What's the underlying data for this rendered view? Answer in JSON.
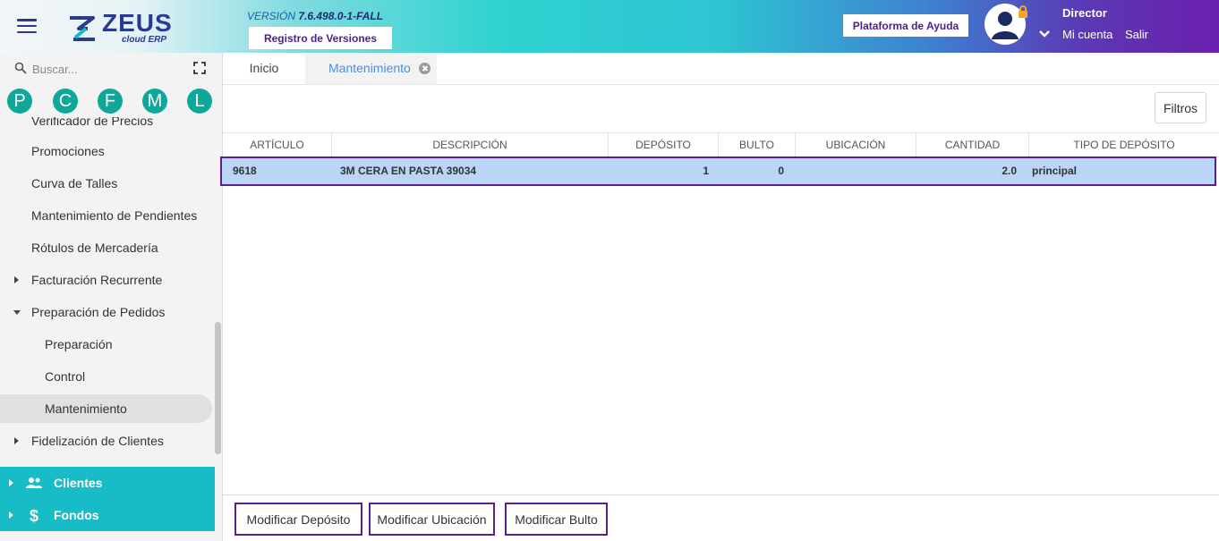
{
  "header": {
    "logo_text": "ZEUS",
    "logo_sub": "cloud ERP",
    "version_label": "VERSIÓN",
    "version_value": "7.6.498.0-1-FALL",
    "registro_label": "Registro de Versiones",
    "ayuda_label": "Plataforma de Ayuda",
    "user_role": "Director",
    "mi_cuenta": "Mi cuenta",
    "salir": "Salir"
  },
  "sidebar": {
    "search_placeholder": "Buscar...",
    "letters": [
      "P",
      "C",
      "F",
      "M",
      "L"
    ],
    "items": [
      {
        "label": "Verificador de Precios"
      },
      {
        "label": "Promociones"
      },
      {
        "label": "Curva de Talles"
      },
      {
        "label": "Mantenimiento de Pendientes"
      },
      {
        "label": "Rótulos de Mercadería"
      },
      {
        "label": "Facturación Recurrente"
      },
      {
        "label": "Preparación de Pedidos"
      },
      {
        "label": "Preparación"
      },
      {
        "label": "Control"
      },
      {
        "label": "Mantenimiento"
      },
      {
        "label": "Fidelización de Clientes"
      }
    ],
    "sections": [
      {
        "label": "Clientes",
        "icon": "people-icon"
      },
      {
        "label": "Fondos",
        "icon": "dollar-icon"
      }
    ]
  },
  "tabs": [
    {
      "label": "Inicio"
    },
    {
      "label": "Mantenimiento"
    }
  ],
  "toolbar": {
    "filtros_label": "Filtros"
  },
  "table": {
    "columns": [
      "ARTÍCULO",
      "DESCRIPCIÓN",
      "DEPÓSITO",
      "BULTO",
      "UBICACIÓN",
      "CANTIDAD",
      "TIPO DE DEPÓSITO"
    ],
    "rows": [
      {
        "articulo": "9618",
        "descripcion": "3M CERA EN PASTA 39034",
        "deposito": "1",
        "bulto": "0",
        "ubicacion": "",
        "cantidad": "2.0",
        "tipo": "principal"
      }
    ]
  },
  "actions": {
    "modificar_deposito": "Modificar Depósito",
    "modificar_ubicacion": "Modificar Ubicación",
    "modificar_bulto": "Modificar Bulto"
  },
  "colors": {
    "accent_purple": "#5b1e8c",
    "teal": "#17bcc6",
    "letter_teal": "#0fa79a",
    "row_selected": "#b9d6f7",
    "tab_active_text": "#4a90d9"
  }
}
